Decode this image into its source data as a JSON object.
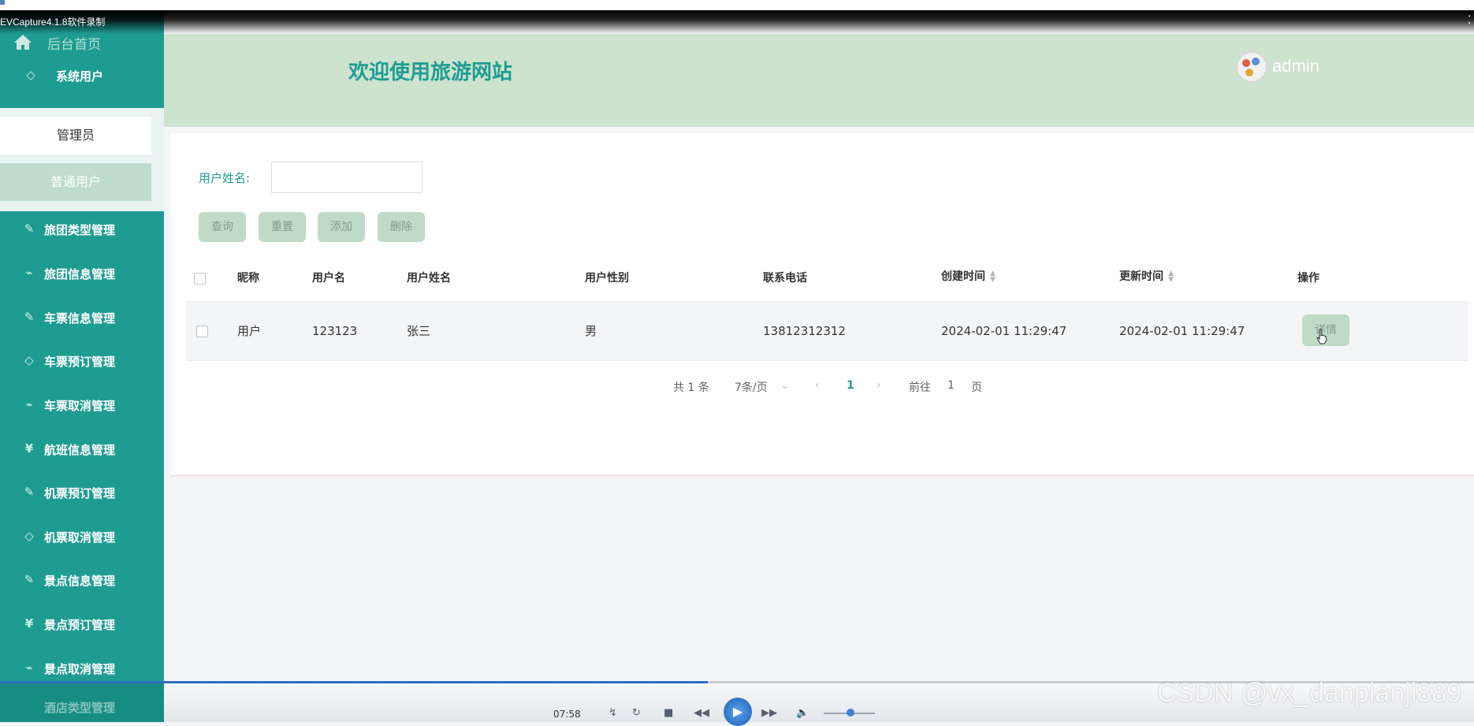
{
  "capture": {
    "title": "EVCapture4.1.8软件录制"
  },
  "sidebar": {
    "home_label": "后台首页",
    "system_users": "系统用户",
    "sub_items": [
      "管理员",
      "普通用户"
    ],
    "items": [
      {
        "label": "旅团类型管理",
        "icon": "edit-icon"
      },
      {
        "label": "旅团信息管理",
        "icon": "chart-icon"
      },
      {
        "label": "车票信息管理",
        "icon": "edit-icon"
      },
      {
        "label": "车票预订管理",
        "icon": "diamond-icon"
      },
      {
        "label": "车票取消管理",
        "icon": "chart-icon"
      },
      {
        "label": "航班信息管理",
        "icon": "yen-icon"
      },
      {
        "label": "机票预订管理",
        "icon": "edit-icon"
      },
      {
        "label": "机票取消管理",
        "icon": "diamond-icon"
      },
      {
        "label": "景点信息管理",
        "icon": "edit-icon"
      },
      {
        "label": "景点预订管理",
        "icon": "yen-icon"
      },
      {
        "label": "景点取消管理",
        "icon": "chart-icon"
      }
    ],
    "bottom_item": "酒店类型管理"
  },
  "header": {
    "title": "欢迎使用旅游网站",
    "username": "admin"
  },
  "search": {
    "label": "用户姓名:",
    "value": ""
  },
  "buttons": {
    "query": "查询",
    "reset": "重置",
    "add": "添加",
    "delete": "删除"
  },
  "table": {
    "columns": [
      "昵称",
      "用户名",
      "用户姓名",
      "用户性别",
      "联系电话",
      "创建时间",
      "更新时间",
      "操作"
    ],
    "rows": [
      {
        "nickname": "用户",
        "username": "123123",
        "real_name": "张三",
        "gender": "男",
        "phone": "13812312312",
        "created": "2024-02-01 11:29:47",
        "updated": "2024-02-01 11:29:47",
        "action": "详情"
      }
    ]
  },
  "pager": {
    "total": "共 1 条",
    "page_size": "7条/页",
    "current": "1",
    "goto_label": "前往",
    "goto_value": "1",
    "page_unit": "页"
  },
  "player": {
    "time": "07:58",
    "progress_percent": 48
  },
  "watermark": "CSDN @vx_danpianji889",
  "colors": {
    "sidebar": "#1f9c92",
    "header": "#cde3cd",
    "button": "#bfdbc7",
    "accent": "#1f9c92"
  }
}
